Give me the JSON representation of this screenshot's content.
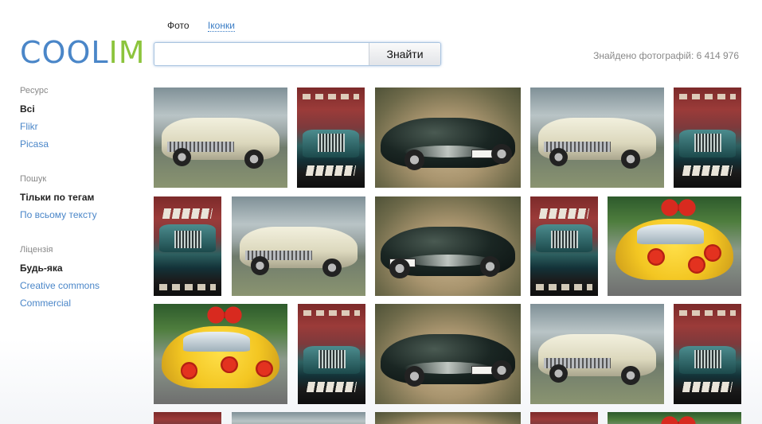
{
  "logo": {
    "part1": "COOL",
    "part2": "IM"
  },
  "tabs": [
    {
      "label": "Фото",
      "active": true
    },
    {
      "label": "Іконки",
      "active": false
    }
  ],
  "search": {
    "value": "",
    "placeholder": "",
    "button_label": "Знайти"
  },
  "results": {
    "found_text": "Знайдено фотографій: 6 414 976"
  },
  "sidebar": {
    "source": {
      "title": "Ресурс",
      "options": [
        "Всі",
        "Flikr",
        "Picasa"
      ],
      "selected": "Всі"
    },
    "search_mode": {
      "title": "Пошук",
      "options": [
        "Тільки по тегам",
        "По всьому тексту"
      ],
      "selected": "Тільки по тегам"
    },
    "license": {
      "title": "Ліцензія",
      "options": [
        "Будь-яка",
        "Creative commons",
        "Commercial"
      ],
      "selected": "Будь-яка"
    }
  },
  "images": [
    "chevy-bel-air-photo",
    "the-car-movie-poster",
    "black-roadster-photo",
    "chevy-bel-air-photo",
    "the-car-movie-poster",
    "the-car-movie-poster-flipped",
    "chevy-bel-air-photo",
    "black-roadster-photo",
    "the-car-movie-poster-flipped",
    "flower-covered-car-photo",
    "flower-covered-car-photo",
    "the-car-movie-poster",
    "black-roadster-photo",
    "chevy-bel-air-photo",
    "the-car-movie-poster"
  ],
  "colors": {
    "accent_blue": "#4a86c8",
    "accent_green": "#8cc43c"
  }
}
